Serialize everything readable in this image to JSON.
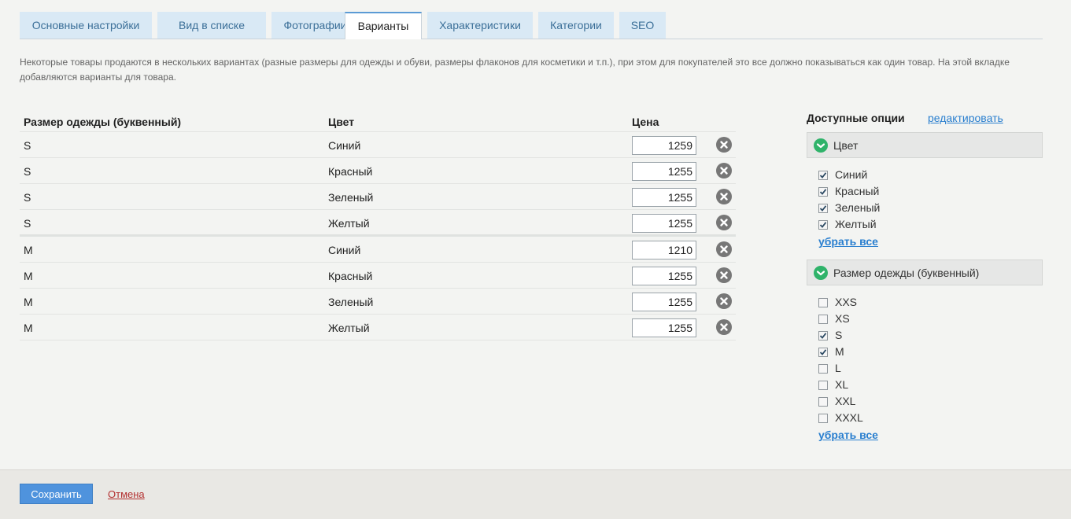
{
  "tabs": [
    {
      "label": "Основные настройки",
      "active": false
    },
    {
      "label": "Вид в списке",
      "active": false
    },
    {
      "label": "Фотографии",
      "active": false
    },
    {
      "label": "Варианты",
      "active": true
    },
    {
      "label": "Характеристики",
      "active": false
    },
    {
      "label": "Категории",
      "active": false
    },
    {
      "label": "SEO",
      "active": false
    }
  ],
  "description": "Некоторые товары продаются в нескольких вариантах (разные размеры для одежды и обуви, размеры флаконов для косметики и т.п.), при этом для покупателей это все должно показываться как один товар. На этой вкладке добавляются варианты для товара.",
  "variants": {
    "headers": {
      "size": "Размер одежды (буквенный)",
      "color": "Цвет",
      "price": "Цена"
    },
    "rows": [
      {
        "size": "S",
        "color": "Синий",
        "price": "1259"
      },
      {
        "size": "S",
        "color": "Красный",
        "price": "1255"
      },
      {
        "size": "S",
        "color": "Зеленый",
        "price": "1255"
      },
      {
        "size": "S",
        "color": "Желтый",
        "price": "1255"
      },
      {
        "size": "M",
        "color": "Синий",
        "price": "1210"
      },
      {
        "size": "M",
        "color": "Красный",
        "price": "1255"
      },
      {
        "size": "M",
        "color": "Зеленый",
        "price": "1255"
      },
      {
        "size": "M",
        "color": "Желтый",
        "price": "1255"
      }
    ]
  },
  "options": {
    "title": "Доступные опции",
    "edit_label": "редактировать",
    "remove_all_label": "убрать все",
    "groups": [
      {
        "name": "Цвет",
        "items": [
          {
            "label": "Синий",
            "checked": true
          },
          {
            "label": "Красный",
            "checked": true
          },
          {
            "label": "Зеленый",
            "checked": true
          },
          {
            "label": "Желтый",
            "checked": true
          }
        ]
      },
      {
        "name": "Размер одежды (буквенный)",
        "items": [
          {
            "label": "XXS",
            "checked": false
          },
          {
            "label": "XS",
            "checked": false
          },
          {
            "label": "S",
            "checked": true
          },
          {
            "label": "M",
            "checked": true
          },
          {
            "label": "L",
            "checked": false
          },
          {
            "label": "XL",
            "checked": false
          },
          {
            "label": "XXL",
            "checked": false
          },
          {
            "label": "XXXL",
            "checked": false
          }
        ]
      }
    ]
  },
  "footer": {
    "save_label": "Сохранить",
    "cancel_label": "Отмена"
  },
  "colors": {
    "accent": "#4f93dd",
    "tab_bg": "#d9e9f5",
    "check_green": "#2fb36a",
    "cancel_red": "#b33030"
  },
  "icons": {
    "delete": "close-circle-icon",
    "group_toggle": "chevron-down-circle-icon",
    "checkbox": "checkmark-icon"
  }
}
